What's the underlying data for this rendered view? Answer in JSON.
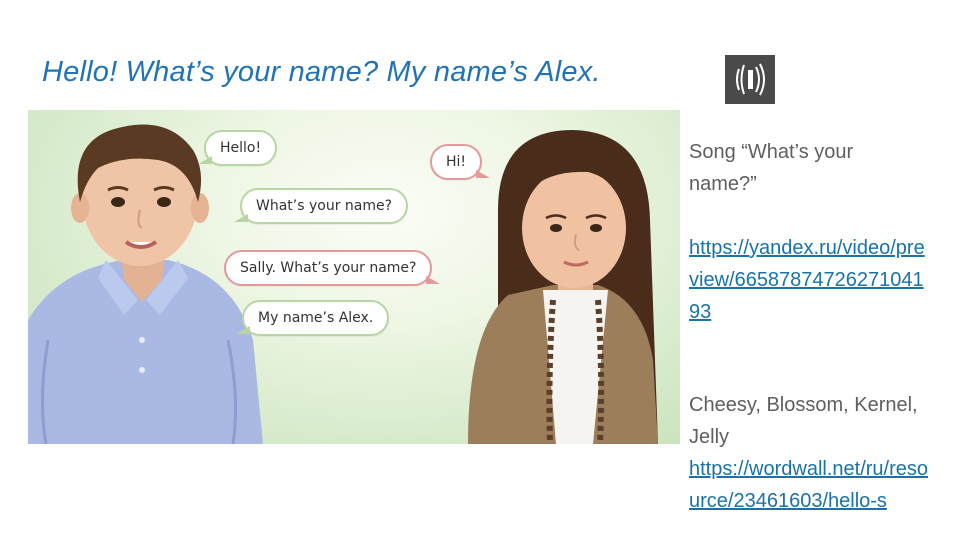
{
  "slide": {
    "title": "Hello! What’s your name? My name’s Alex.",
    "sound_icon": "speaker-sound-icon"
  },
  "illustration": {
    "bubbles": {
      "hello": "Hello!",
      "hi": "Hi!",
      "whats_your_name": "What’s your name?",
      "sally": "Sally. What’s your name?",
      "alex": "My name’s Alex."
    }
  },
  "sidebar": {
    "song_label": "Song “What’s your name?”",
    "song_link": "https://yandex.ru/video/preview/6658787472627104193",
    "characters": "Cheesy, Blossom, Kernel, Jelly",
    "wordwall_link": "https://wordwall.net/ru/resource/23461603/hello-s"
  },
  "colors": {
    "title": "#1f73b6",
    "link": "#1a73a8",
    "body_text": "#5f5f5f",
    "bubble_green_border": "#b8d6a4",
    "bubble_red_border": "#e39a9a"
  }
}
